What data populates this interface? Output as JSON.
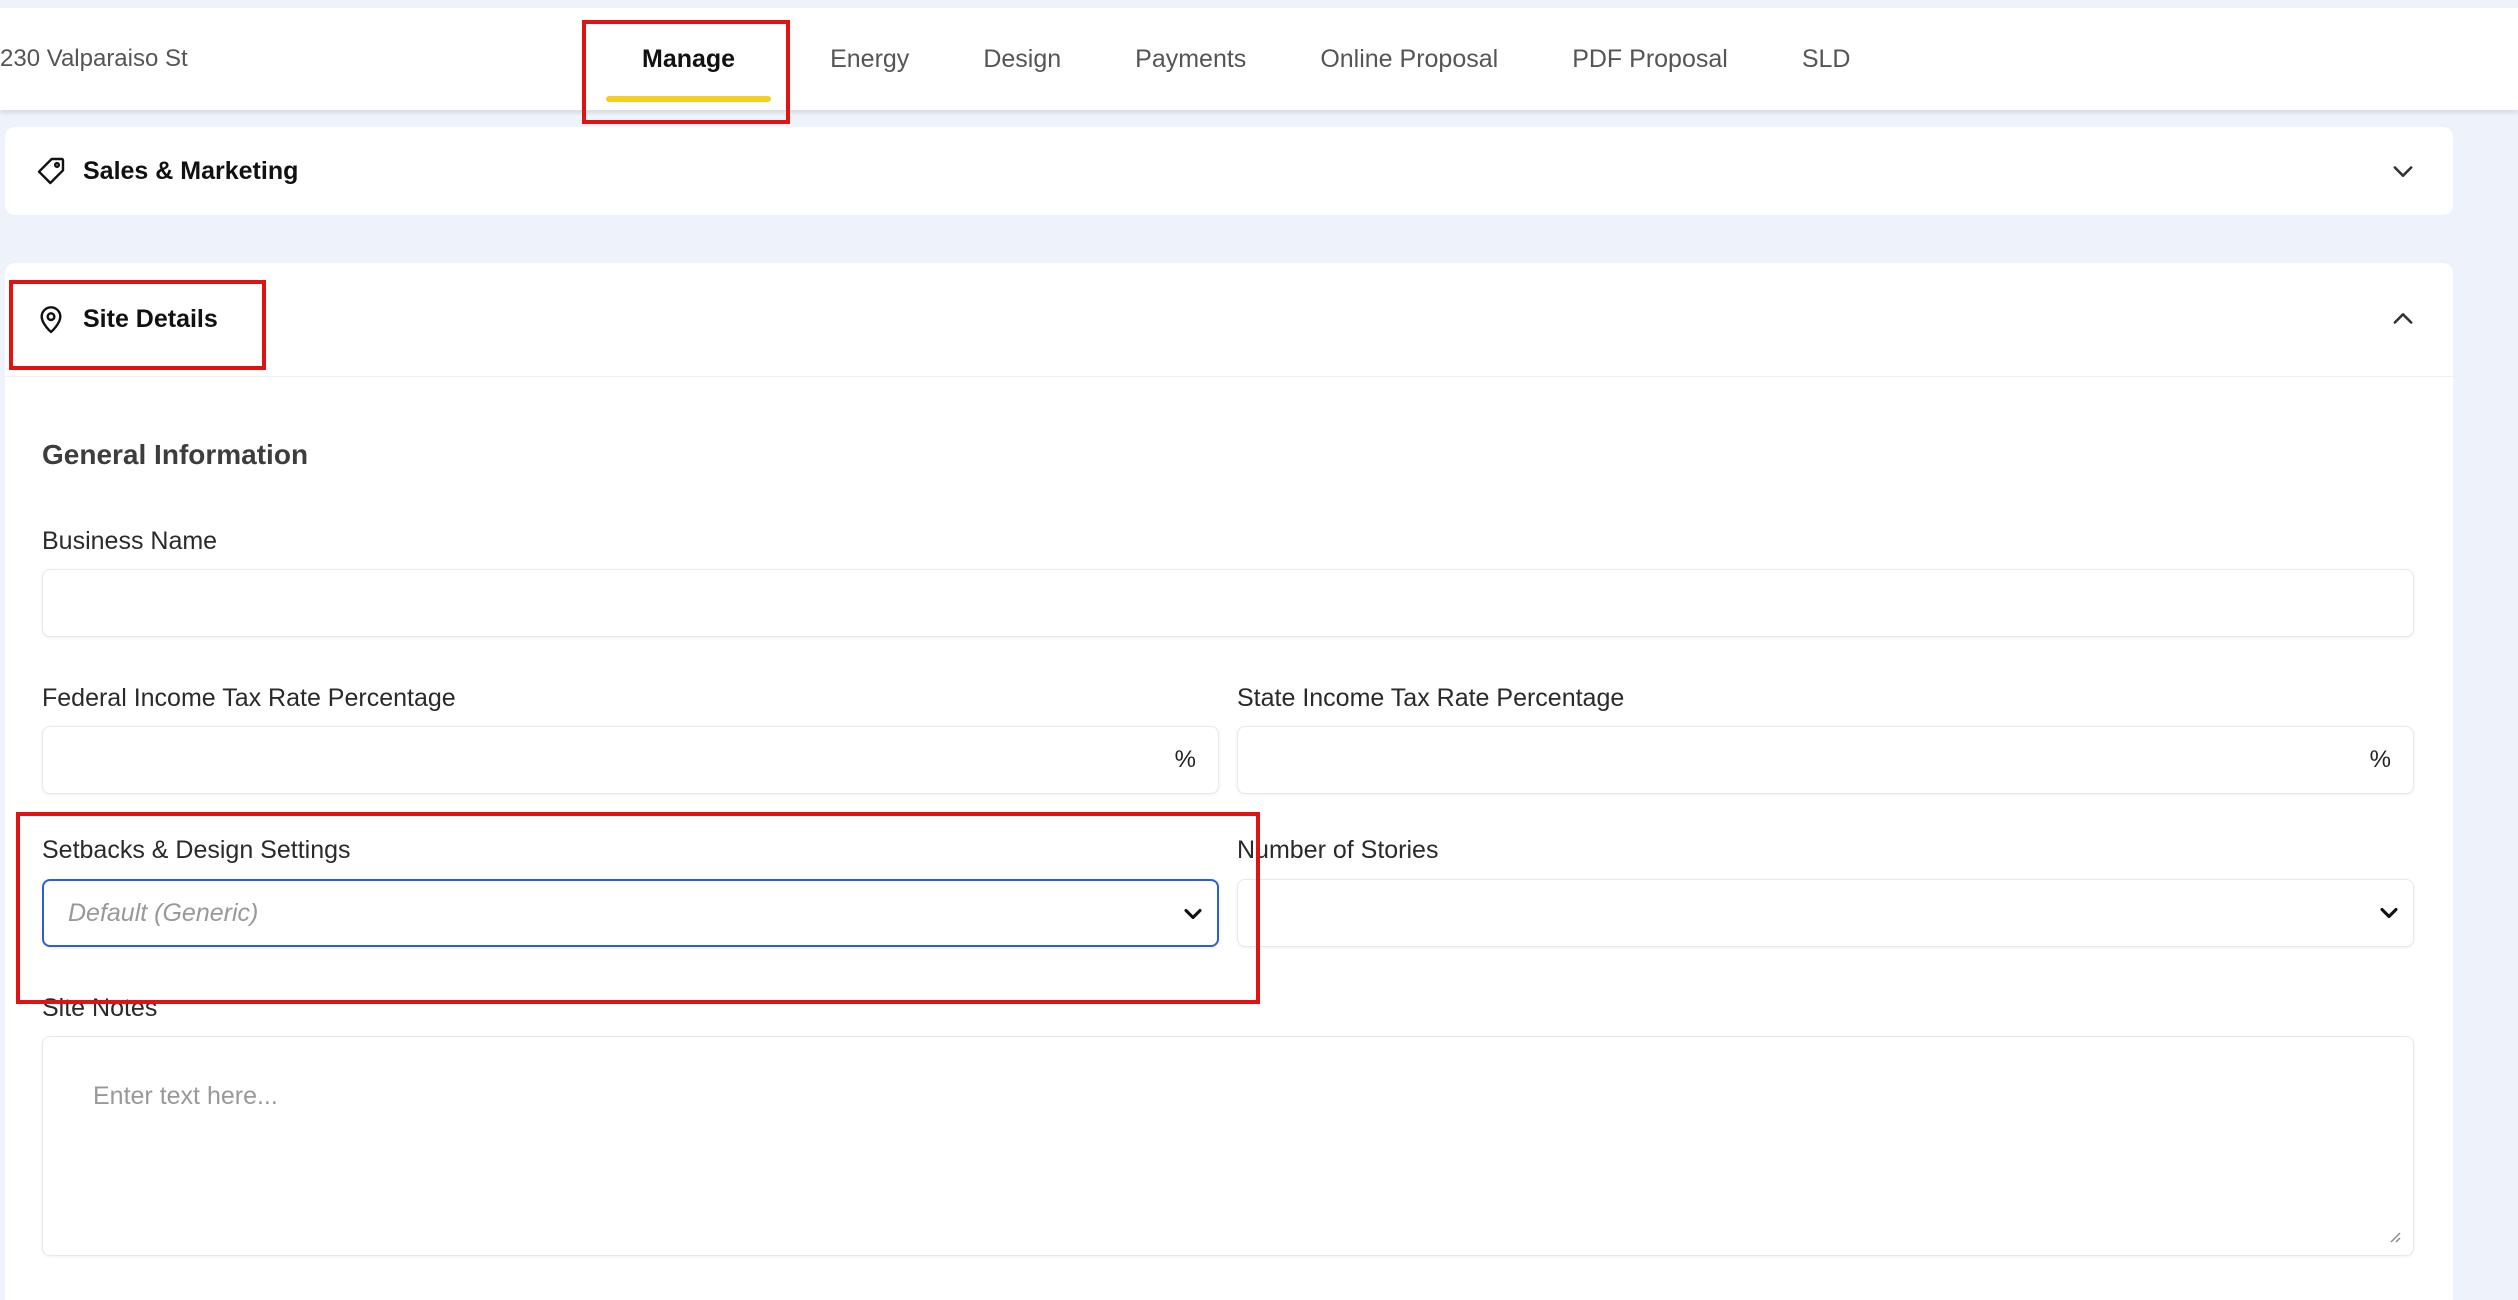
{
  "header": {
    "address": "230 Valparaiso St",
    "tabs": [
      {
        "label": "Manage",
        "active": true
      },
      {
        "label": "Energy"
      },
      {
        "label": "Design"
      },
      {
        "label": "Payments"
      },
      {
        "label": "Online Proposal"
      },
      {
        "label": "PDF Proposal"
      },
      {
        "label": "SLD"
      }
    ]
  },
  "sections": {
    "sales": {
      "title": "Sales & Marketing",
      "icon": "tag-icon",
      "expanded": false
    },
    "site": {
      "title": "Site Details",
      "icon": "map-pin-icon",
      "expanded": true
    }
  },
  "form": {
    "section_title": "General Information",
    "business_name": {
      "label": "Business Name",
      "value": ""
    },
    "federal_tax": {
      "label": "Federal Income Tax Rate Percentage",
      "value": "",
      "suffix": "%"
    },
    "state_tax": {
      "label": "State Income Tax Rate Percentage",
      "value": "",
      "suffix": "%"
    },
    "setbacks": {
      "label": "Setbacks & Design Settings",
      "placeholder": "Default (Generic)"
    },
    "stories": {
      "label": "Number of Stories",
      "value": ""
    },
    "site_notes": {
      "label": "Site Notes",
      "placeholder": "Enter text here..."
    }
  },
  "colors": {
    "accent_underline": "#f5ce22",
    "focus_border": "#2b5fd8",
    "highlight": "#e31212"
  }
}
